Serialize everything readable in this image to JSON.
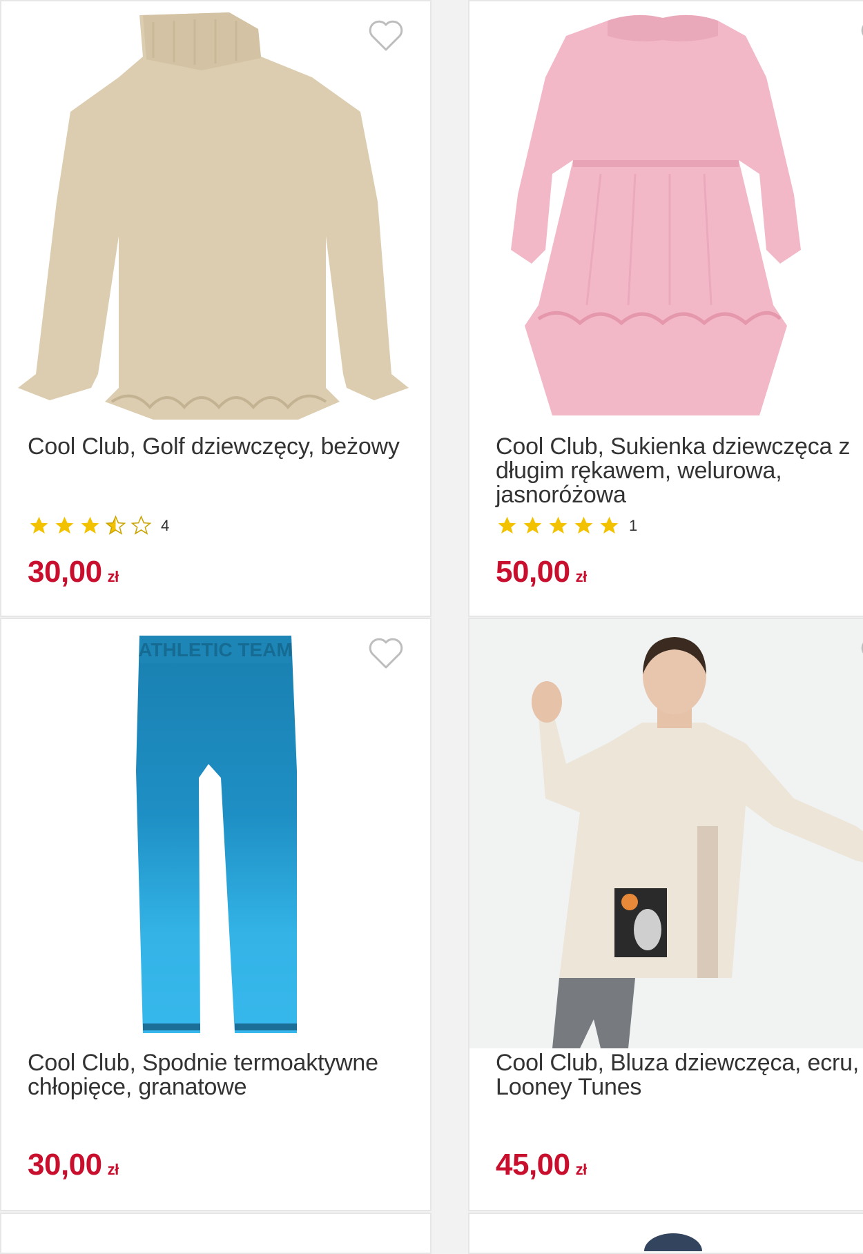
{
  "products": [
    {
      "title": "Cool Club, Golf dziewczęcy, beżowy",
      "rating": 3.5,
      "rating_count": "4",
      "price": "30,00",
      "currency": "zł"
    },
    {
      "title": "Cool Club, Sukienka dziewczęca z długim rękawem, welurowa, jasnoróżowa",
      "rating": 5,
      "rating_count": "1",
      "price": "50,00",
      "currency": "zł"
    },
    {
      "title": "Cool Club, Spodnie termoaktywne chłopięce, granatowe",
      "price": "30,00",
      "currency": "zł"
    },
    {
      "title": "Cool Club, Bluza dziewczęca, ecru, Looney Tunes",
      "price": "45,00",
      "currency": "zł"
    }
  ],
  "leggings_print": "ATHLETIC TEAM",
  "colors": {
    "price": "#c8102e",
    "star": "#f2c200",
    "star_empty": "#c9a400",
    "heart": "#bdbdbd"
  }
}
